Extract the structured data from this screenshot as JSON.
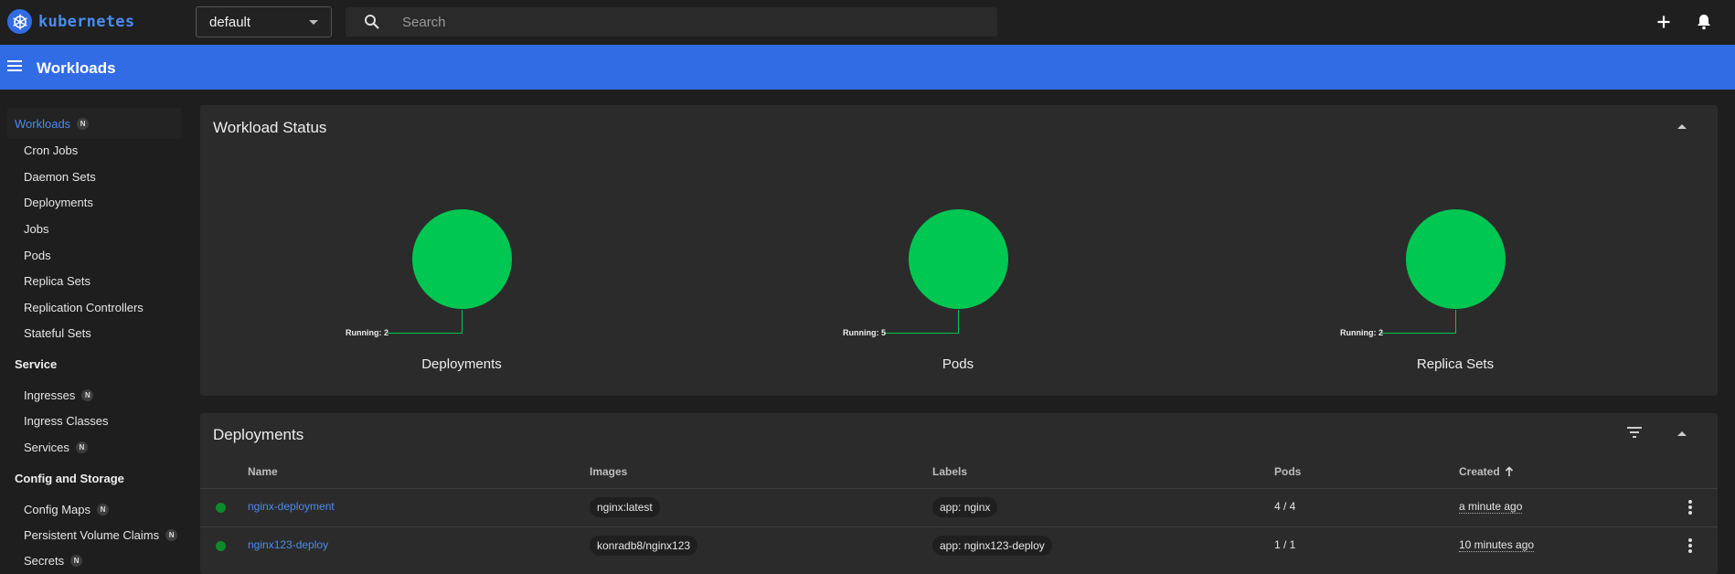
{
  "app": {
    "logo_text": "kubernetes"
  },
  "topbar": {
    "namespace": "default",
    "search_placeholder": "Search",
    "icons": [
      "plus-icon",
      "bell-icon"
    ]
  },
  "header": {
    "title": "Workloads"
  },
  "sidebar": {
    "active": {
      "label": "Workloads",
      "badge": "N"
    },
    "workloads_items": [
      {
        "label": "Cron Jobs"
      },
      {
        "label": "Daemon Sets"
      },
      {
        "label": "Deployments"
      },
      {
        "label": "Jobs"
      },
      {
        "label": "Pods"
      },
      {
        "label": "Replica Sets"
      },
      {
        "label": "Replication Controllers"
      },
      {
        "label": "Stateful Sets"
      }
    ],
    "service_section": "Service",
    "service_items": [
      {
        "label": "Ingresses",
        "badge": "N"
      },
      {
        "label": "Ingress Classes"
      },
      {
        "label": "Services",
        "badge": "N"
      }
    ],
    "config_section": "Config and Storage",
    "config_items": [
      {
        "label": "Config Maps",
        "badge": "N"
      },
      {
        "label": "Persistent Volume Claims",
        "badge": "N"
      },
      {
        "label": "Secrets",
        "badge": "N"
      }
    ]
  },
  "workload_status": {
    "title": "Workload Status",
    "charts": [
      {
        "name": "Deployments",
        "running_label": "Running: 2",
        "running": 2
      },
      {
        "name": "Pods",
        "running_label": "Running: 5",
        "running": 5
      },
      {
        "name": "Replica Sets",
        "running_label": "Running: 2",
        "running": 2
      }
    ],
    "colors": {
      "running": "#00c752"
    }
  },
  "deployments": {
    "title": "Deployments",
    "columns": {
      "name": "Name",
      "images": "Images",
      "labels": "Labels",
      "pods": "Pods",
      "created": "Created"
    },
    "rows": [
      {
        "name": "nginx-deployment",
        "image": "nginx:latest",
        "label": "app: nginx",
        "pods": "4 / 4",
        "created": "a minute ago",
        "status_color": "#0f8a2b"
      },
      {
        "name": "nginx123-deploy",
        "image": "konradb8/nginx123",
        "label": "app: nginx123-deploy",
        "pods": "1 / 1",
        "created": "10 minutes ago",
        "status_color": "#0f8a2b"
      }
    ]
  },
  "colors": {
    "accent": "#326ce5",
    "link": "#4b8bf0"
  }
}
